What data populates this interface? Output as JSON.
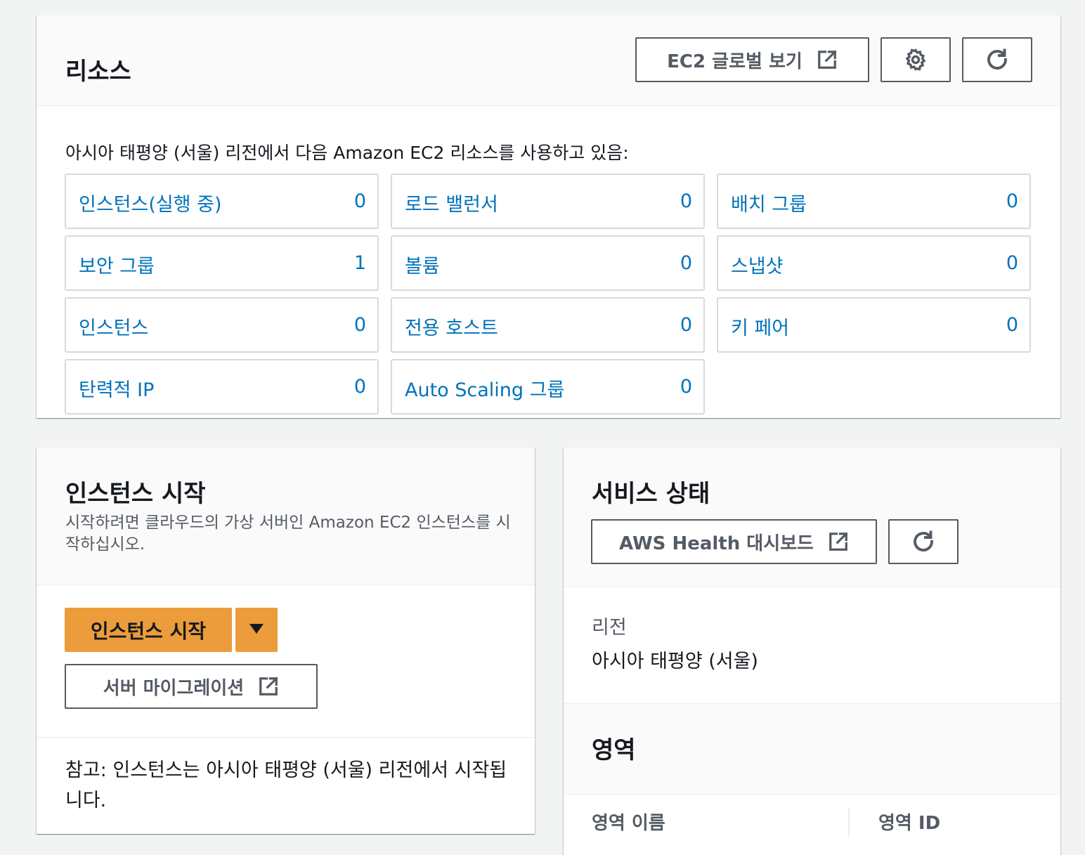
{
  "colors": {
    "link": "#0073bb",
    "primary_button": "#ec9c3a",
    "button_border": "#545b64",
    "panel_header_bg": "#fafafa",
    "page_bg": "#f2f3f3"
  },
  "resources": {
    "title": "리소스",
    "global_view_label": "EC2 글로벌 보기",
    "global_view_icon": "external-link-icon",
    "settings_icon": "gear-icon",
    "refresh_icon": "refresh-icon",
    "description": "아시아 태평양 (서울) 리전에서 다음 Amazon EC2 리소스를 사용하고 있음:",
    "items": [
      {
        "label": "인스턴스(실행 중)",
        "count": "0"
      },
      {
        "label": "로드 밸런서",
        "count": "0"
      },
      {
        "label": "배치 그룹",
        "count": "0"
      },
      {
        "label": "보안 그룹",
        "count": "1"
      },
      {
        "label": "볼륨",
        "count": "0"
      },
      {
        "label": "스냅샷",
        "count": "0"
      },
      {
        "label": "인스턴스",
        "count": "0"
      },
      {
        "label": "전용 호스트",
        "count": "0"
      },
      {
        "label": "키 페어",
        "count": "0"
      },
      {
        "label": "탄력적 IP",
        "count": "0"
      },
      {
        "label": "Auto Scaling 그룹",
        "count": "0"
      }
    ]
  },
  "launch": {
    "title": "인스턴스 시작",
    "description": "시작하려면 클라우드의 가상 서버인 Amazon EC2 인스턴스를 시작하십시오.",
    "launch_button": "인스턴스 시작",
    "dropdown_icon": "caret-down-icon",
    "migration_button": "서버 마이그레이션",
    "note": "참고: 인스턴스는 아시아 태평양 (서울) 리전에서 시작됩니다."
  },
  "status": {
    "title": "서비스 상태",
    "health_button": "AWS Health 대시보드",
    "region_label": "리전",
    "region_value": "아시아 태평양 (서울)",
    "zones_title": "영역",
    "zone_col_name": "영역 이름",
    "zone_col_id": "영역 ID"
  }
}
